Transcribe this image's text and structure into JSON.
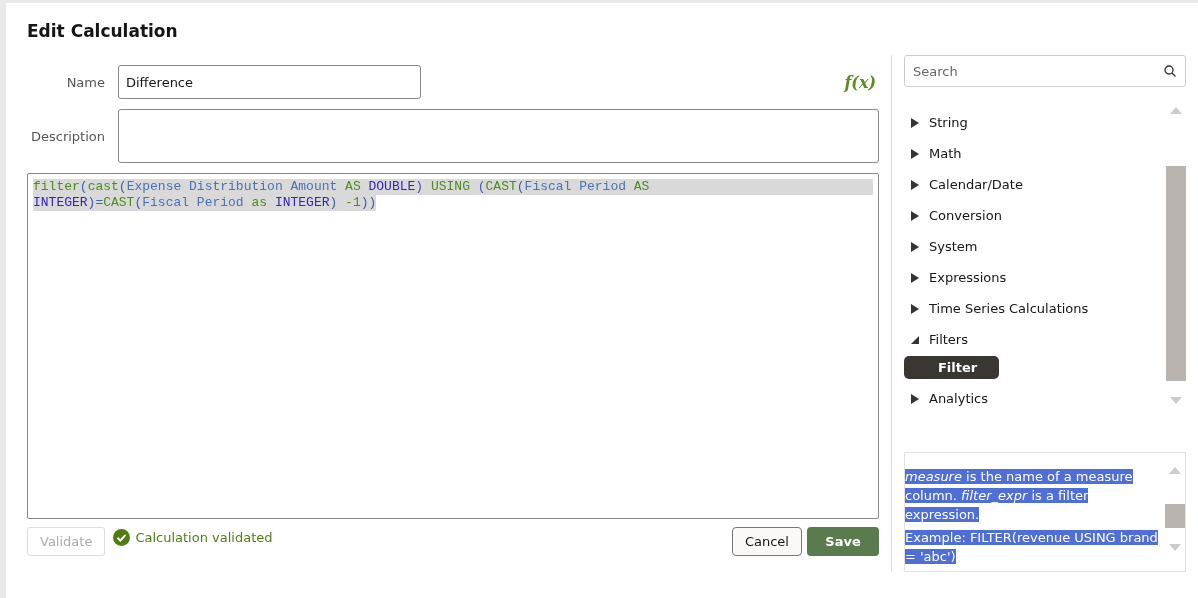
{
  "dialog": {
    "title": "Edit Calculation"
  },
  "form": {
    "name_label": "Name",
    "name_value": "Difference",
    "description_label": "Description",
    "function_icon": "f(x)"
  },
  "expression": {
    "selected": true,
    "lines": [
      [
        {
          "text": "filter",
          "kind": "function"
        },
        {
          "text": "(",
          "kind": "punct"
        },
        {
          "text": "cast",
          "kind": "function"
        },
        {
          "text": "(",
          "kind": "punct"
        },
        {
          "text": "Expense Distribution Amount ",
          "kind": "column"
        },
        {
          "text": "AS ",
          "kind": "keyword"
        },
        {
          "text": "DOUBLE",
          "kind": "type"
        },
        {
          "text": ") ",
          "kind": "punct"
        },
        {
          "text": "USING",
          "kind": "keyword"
        },
        {
          "text": " (",
          "kind": "punct"
        },
        {
          "text": "CAST",
          "kind": "function"
        },
        {
          "text": "(",
          "kind": "punct"
        },
        {
          "text": "Fiscal Period ",
          "kind": "column"
        },
        {
          "text": "AS",
          "kind": "keyword"
        }
      ],
      [
        {
          "text": "INTEGER",
          "kind": "type"
        },
        {
          "text": ")=",
          "kind": "punct"
        },
        {
          "text": "CAST",
          "kind": "function"
        },
        {
          "text": "(",
          "kind": "punct"
        },
        {
          "text": "Fiscal Period ",
          "kind": "column"
        },
        {
          "text": "as ",
          "kind": "keyword"
        },
        {
          "text": "INTEGER",
          "kind": "type"
        },
        {
          "text": ") ",
          "kind": "punct"
        },
        {
          "text": "-1",
          "kind": "number"
        },
        {
          "text": "))",
          "kind": "punct"
        }
      ]
    ]
  },
  "footer": {
    "validate": {
      "label": "Validate",
      "disabled": true
    },
    "status": "Calculation validated",
    "cancel": "Cancel",
    "save": "Save"
  },
  "functions": {
    "search_placeholder": "Search",
    "items": [
      {
        "label": "String",
        "expanded": false
      },
      {
        "label": "Math",
        "expanded": false
      },
      {
        "label": "Calendar/Date",
        "expanded": false
      },
      {
        "label": "Conversion",
        "expanded": false
      },
      {
        "label": "System",
        "expanded": false
      },
      {
        "label": "Expressions",
        "expanded": false
      },
      {
        "label": "Time Series Calculations",
        "expanded": false
      },
      {
        "label": "Filters",
        "expanded": true,
        "children": [
          {
            "label": "Filter",
            "selected": true
          }
        ]
      },
      {
        "label": "Analytics",
        "expanded": false
      }
    ]
  },
  "help": {
    "selected": true,
    "paragraphs": [
      "*measure* is the name of a measure column. *filter_expr* is a filter expression.",
      "Example: FILTER(revenue USING brand = 'abc')"
    ]
  }
}
